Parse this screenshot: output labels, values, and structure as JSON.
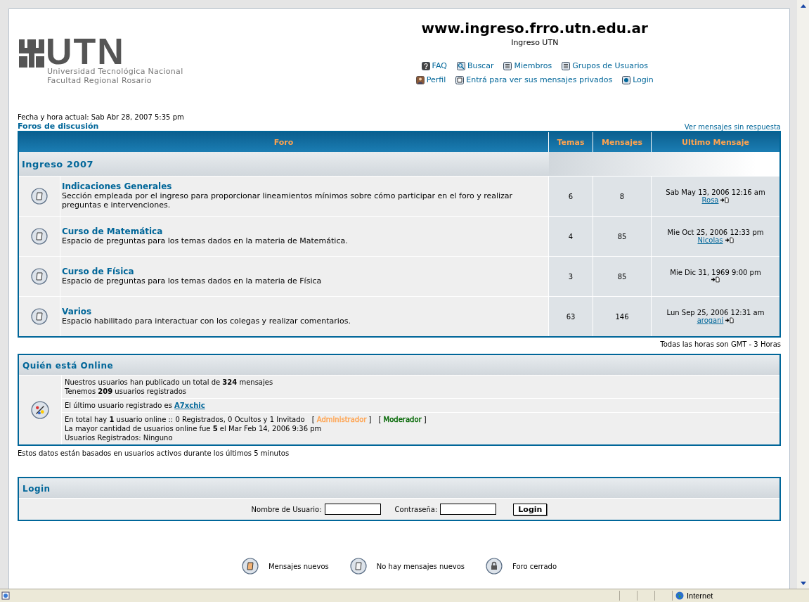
{
  "logo": {
    "mark": "UTN",
    "line1": "Universidad Tecnológica Nacional",
    "line2": "Facultad Regional Rosario"
  },
  "site": {
    "title": "www.ingreso.frro.utn.edu.ar",
    "subtitle": "Ingreso UTN"
  },
  "nav": [
    [
      {
        "kind": "faq",
        "label": "FAQ"
      },
      {
        "kind": "search",
        "label": "Buscar"
      },
      {
        "kind": "members",
        "label": "Miembros"
      },
      {
        "kind": "groups",
        "label": "Grupos de Usuarios"
      }
    ],
    [
      {
        "kind": "profile",
        "label": "Perfil"
      },
      {
        "kind": "messages",
        "label": "Entrá para ver sus mensajes privados"
      },
      {
        "kind": "login",
        "label": "Login"
      }
    ]
  ],
  "datetime": "Fecha y hora actual: Sab Abr 28, 2007 5:35 pm",
  "breadcrumb": "Foros de discusión",
  "unanswered_link": "Ver mensajes sin respuesta",
  "table": {
    "columns": [
      "Foro",
      "Temas",
      "Mensajes",
      "Ultimo Mensaje"
    ],
    "category": "Ingreso 2007",
    "rows": [
      {
        "kind": "none",
        "name": "Indicaciones Generales",
        "description": "Sección empleada por el ingreso para proporcionar lineamientos mínimos sobre cómo participar en el foro y realizar preguntas e intervenciones.",
        "topics": "6",
        "posts": "8",
        "last_date": "Sab May 13, 2006 12:16 am",
        "last_author": "Rosa"
      },
      {
        "kind": "none",
        "name": "Curso de Matemática",
        "description": "Espacio de preguntas para los temas dados en la materia de Matemática.",
        "topics": "4",
        "posts": "85",
        "last_date": "Mie Oct 25, 2006 12:33 pm",
        "last_author": "Nicolas"
      },
      {
        "kind": "none",
        "name": "Curso de Física",
        "description": "Espacio de preguntas para los temas dados en la materia de Física",
        "topics": "3",
        "posts": "85",
        "last_date": "Mie Dic 31, 1969 9:00 pm"
      },
      {
        "kind": "none",
        "name": "Varios",
        "description": "Espacio habilitado para interactuar con los colegas y realizar comentarios.",
        "topics": "63",
        "posts": "146",
        "last_date": "Lun Sep 25, 2006 12:31 am",
        "last_author": "arogani"
      }
    ]
  },
  "timezone": "Todas las horas son GMT - 3 Horas",
  "online": {
    "title": "Quién está Online",
    "stats": [
      "Nuestros usuarios han publicado un total de **324** mensajes",
      "Tenemos **209** usuarios registrados"
    ],
    "newest_text": "El último usuario registrado es",
    "newest_user": "A7xchic",
    "total": "En total hay **1** usuario online :: 0 Registrados, 0 Ocultos y 1 Invitado",
    "legend": [
      {
        "open": "[",
        "label": "Administrador",
        "close": "]",
        "color": "#ffa34f"
      },
      {
        "open": "[",
        "label": "Moderador",
        "close": "]",
        "color": "#006600"
      }
    ],
    "details": [
      "La mayor cantidad de usuarios online fue **5** el Mar Feb 14, 2006 9:36 pm",
      "Usuarios Registrados: Ninguno"
    ]
  },
  "online_note": "Estos datos están basados en usuarios activos durante los últimos 5 minutos",
  "login": {
    "title": "Login",
    "user_label": "Nombre de Usuario:",
    "password_label": "Contraseña:",
    "button": "Login"
  },
  "legend": [
    {
      "kind": "new",
      "label": "Mensajes nuevos"
    },
    {
      "kind": "none",
      "label": "No hay mensajes nuevos"
    },
    {
      "kind": "locked",
      "label": "Foro cerrado"
    }
  ],
  "status_bar": {
    "zone": "Internet"
  }
}
